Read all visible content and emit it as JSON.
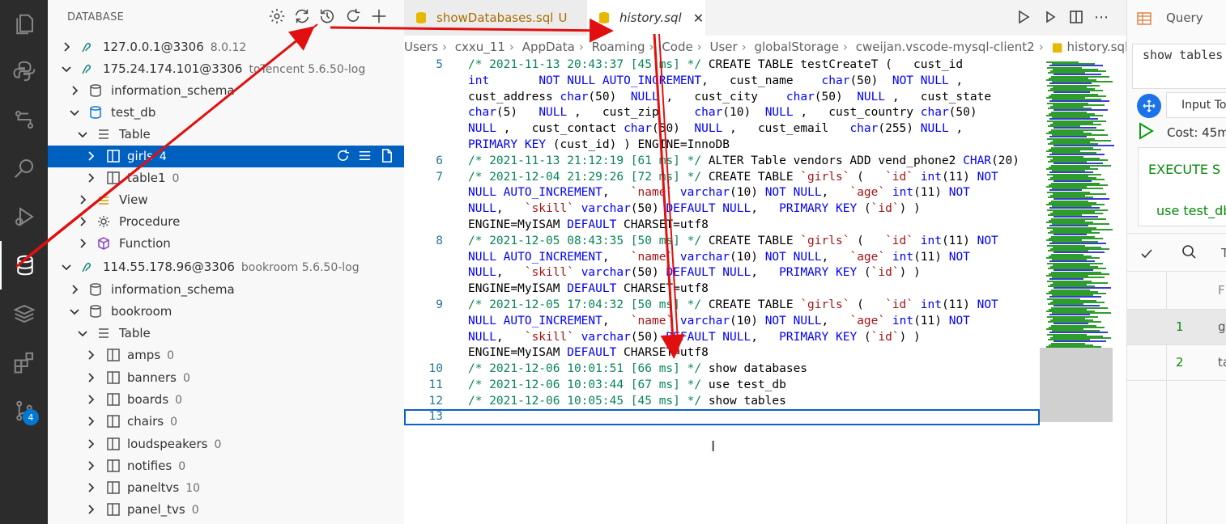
{
  "sidebar": {
    "title": "DATABASE",
    "rows": [
      {
        "label": "127.0.0.1@3306",
        "desc": "8.0.12"
      },
      {
        "label": "175.24.174.101@3306",
        "desc": "toTencent 5.6.50-log"
      },
      {
        "label": "information_schema",
        "desc": ""
      },
      {
        "label": "test_db",
        "desc": ""
      },
      {
        "label": "Table",
        "desc": ""
      },
      {
        "label": "girls",
        "desc": "4"
      },
      {
        "label": "table1",
        "desc": "0"
      },
      {
        "label": "View",
        "desc": ""
      },
      {
        "label": "Procedure",
        "desc": ""
      },
      {
        "label": "Function",
        "desc": ""
      },
      {
        "label": "114.55.178.96@3306",
        "desc": "bookroom 5.6.50-log"
      },
      {
        "label": "information_schema",
        "desc": ""
      },
      {
        "label": "bookroom",
        "desc": ""
      },
      {
        "label": "Table",
        "desc": ""
      },
      {
        "label": "amps",
        "desc": "0"
      },
      {
        "label": "banners",
        "desc": "0"
      },
      {
        "label": "boards",
        "desc": "0"
      },
      {
        "label": "chairs",
        "desc": "0"
      },
      {
        "label": "loudspeakers",
        "desc": "0"
      },
      {
        "label": "notifies",
        "desc": "0"
      },
      {
        "label": "paneltvs",
        "desc": "10"
      },
      {
        "label": "panel_tvs",
        "desc": "0"
      }
    ]
  },
  "activity": {
    "scm_badge": "4"
  },
  "tabs": [
    {
      "label": "showDatabases.sql",
      "status": "U"
    },
    {
      "label": "history.sql",
      "close": "✕"
    }
  ],
  "breadcrumb": [
    "Users",
    "cxxu_11",
    "AppData",
    "Roaming",
    "Code",
    "User",
    "globalStorage",
    "cweijan.vscode-mysql-client2",
    "history.sql",
    "..."
  ],
  "editor": {
    "line_numbers": [
      "5",
      "6",
      "7",
      "8",
      "9",
      "10",
      "11",
      "12",
      "13"
    ],
    "lines": [
      "/* 2021-11-13 20:43:37 [45 ms] */ CREATE TABLE testCreateT (   cust_id",
      "int       NOT NULL AUTO_INCREMENT,   cust_name    char(50)  NOT NULL ,",
      "cust_address char(50)  NULL ,   cust_city    char(50)  NULL ,   cust_state",
      "char(5)   NULL ,   cust_zip     char(10)  NULL ,   cust_country char(50)",
      "NULL ,   cust_contact char(50)  NULL ,   cust_email   char(255) NULL ,",
      "PRIMARY KEY (cust_id) ) ENGINE=InnoDB",
      "/* 2021-11-13 21:12:19 [61 ms] */ ALTER Table vendors ADD vend_phone2 CHAR(20)",
      "/* 2021-12-04 21:29:26 [72 ms] */ CREATE TABLE `girls` (   `id` int(11) NOT",
      "NULL AUTO_INCREMENT,   `name` varchar(10) NOT NULL,   `age` int(11) NOT",
      "NULL,   `skill` varchar(50) DEFAULT NULL,   PRIMARY KEY (`id`) )",
      "ENGINE=MyISAM DEFAULT CHARSET=utf8",
      "/* 2021-12-05 08:43:35 [50 ms] */ CREATE TABLE `girls` (   `id` int(11) NOT",
      "NULL AUTO_INCREMENT,   `name` varchar(10) NOT NULL,   `age` int(11) NOT",
      "NULL,   `skill` varchar(50) DEFAULT NULL,   PRIMARY KEY (`id`) )",
      "ENGINE=MyISAM DEFAULT CHARSET=utf8",
      "/* 2021-12-05 17:04:32 [50 ms] */ CREATE TABLE `girls` (   `id` int(11) NOT",
      "NULL AUTO_INCREMENT,   `name` varchar(10) NOT NULL,   `age` int(11) NOT",
      "NULL,   `skill` varchar(50) DEFAULT NULL,   PRIMARY KEY (`id`) )",
      "ENGINE=MyISAM DEFAULT CHARSET=utf8",
      "/* 2021-12-06 10:01:51 [66 ms] */ show databases",
      "/* 2021-12-06 10:03:44 [67 ms] */ use test_db",
      "/* 2021-12-06 10:05:45 [45 ms] */ show tables"
    ]
  },
  "query_panel": {
    "title": "Query",
    "sql": "show tables",
    "input_to": "Input To",
    "cost": "Cost: 45m",
    "execute": "EXECUTE S",
    "use": "use test_db",
    "header_col": "T",
    "col_f": "F",
    "rows": [
      {
        "num": "1",
        "text": "gi"
      },
      {
        "num": "2",
        "text": "ta"
      }
    ]
  },
  "colors": {
    "accent": "#0060c0",
    "annotation": "#e01010",
    "sql_comment": "#098658",
    "sql_keyword": "#0000ff"
  }
}
